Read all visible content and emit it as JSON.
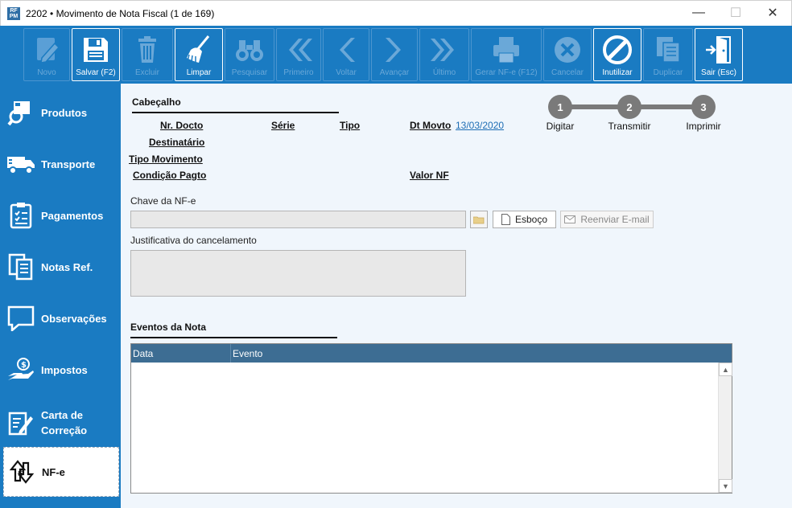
{
  "window": {
    "title": "2202 • Movimento de Nota Fiscal (1 de 169)",
    "icon_text": "RF\nPM",
    "minimize": "—",
    "maximize": "☐",
    "close": "✕"
  },
  "toolbar": {
    "buttons": [
      {
        "label": "Novo",
        "icon": "edit-icon",
        "enabled": false
      },
      {
        "label": "Salvar (F2)",
        "icon": "save-icon",
        "enabled": true
      },
      {
        "label": "Excluir",
        "icon": "trash-icon",
        "enabled": false
      },
      {
        "label": "Limpar",
        "icon": "broom-icon",
        "enabled": true
      },
      {
        "label": "Pesquisar",
        "icon": "binoculars-icon",
        "enabled": false
      },
      {
        "label": "Primeiro",
        "icon": "first-icon",
        "enabled": false
      },
      {
        "label": "Voltar",
        "icon": "prev-icon",
        "enabled": false
      },
      {
        "label": "Avançar",
        "icon": "next-icon",
        "enabled": false
      },
      {
        "label": "Último",
        "icon": "last-icon",
        "enabled": false
      },
      {
        "label": "Gerar NF-e (F12)",
        "icon": "printer-icon",
        "enabled": false
      },
      {
        "label": "Cancelar",
        "icon": "cancel-icon",
        "enabled": false
      },
      {
        "label": "Inutilizar",
        "icon": "prohibit-icon",
        "enabled": true
      },
      {
        "label": "Duplicar",
        "icon": "duplicate-icon",
        "enabled": false
      },
      {
        "label": "Sair (Esc)",
        "icon": "exit-door-icon",
        "enabled": true
      }
    ]
  },
  "sidebar": {
    "items": [
      {
        "label": "Produtos",
        "icon": "products-search-icon"
      },
      {
        "label": "Transporte",
        "icon": "truck-icon"
      },
      {
        "label": "Pagamentos",
        "icon": "clipboard-icon"
      },
      {
        "label": "Notas Ref.",
        "icon": "documents-icon"
      },
      {
        "label": "Observações",
        "icon": "speech-bubble-icon"
      },
      {
        "label": "Impostos",
        "icon": "hand-coin-icon"
      },
      {
        "label": "Carta de\nCorreção",
        "icon": "edit-document-icon"
      },
      {
        "label": "NF-e",
        "icon": "nfe-transfer-icon"
      }
    ],
    "selected": "NF-e"
  },
  "header": {
    "title": "Cabeçalho",
    "nr_docto_label": "Nr. Docto",
    "serie_label": "Série",
    "tipo_label": "Tipo",
    "dt_movto_label": "Dt Movto",
    "dt_movto_value": "13/03/2020",
    "destinatario_label": "Destinatário",
    "tipo_movimento_label": "Tipo Movimento",
    "condicao_pagto_label": "Condição Pagto",
    "valor_nf_label": "Valor NF"
  },
  "steps": [
    {
      "number": "1",
      "label": "Digitar"
    },
    {
      "number": "2",
      "label": "Transmitir"
    },
    {
      "number": "3",
      "label": "Imprimir"
    }
  ],
  "nfe": {
    "chave_label": "Chave da NF-e",
    "chave_value": "",
    "esboco_button": "Esboço",
    "reenviar_button": "Reenviar E-mail",
    "justificativa_label": "Justificativa do cancelamento",
    "justificativa_value": ""
  },
  "eventos": {
    "title": "Eventos da Nota",
    "columns": [
      "Data",
      "Evento"
    ],
    "rows": []
  },
  "colors": {
    "brand_blue": "#1a7bc2",
    "grid_header": "#3d6d93",
    "step_gray": "#7a7a7a",
    "link_blue": "#1e6eb5"
  }
}
